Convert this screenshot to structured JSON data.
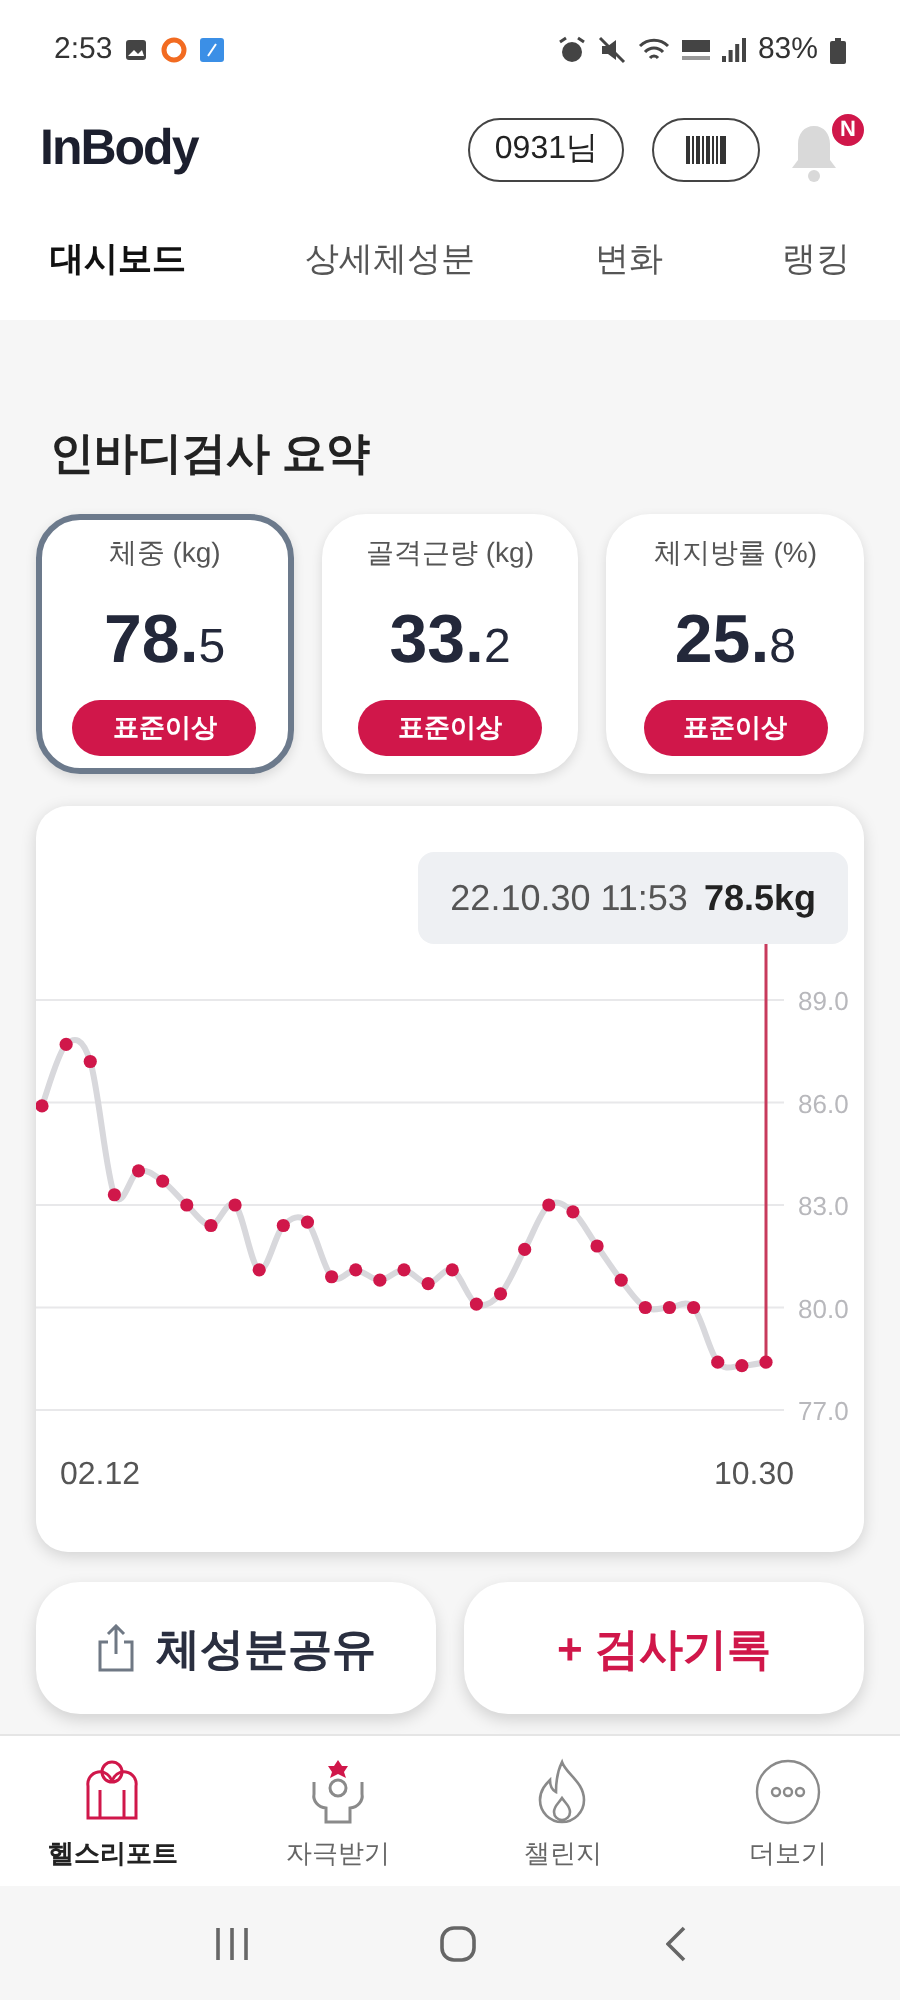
{
  "status_bar": {
    "time": "2:53",
    "battery": "83%"
  },
  "header": {
    "logo": "InBody",
    "user_button": "0931님",
    "notification_badge": "N"
  },
  "tabs": [
    {
      "label": "대시보드",
      "selected": true
    },
    {
      "label": "상세체성분",
      "selected": false
    },
    {
      "label": "변화",
      "selected": false
    },
    {
      "label": "랭킹",
      "selected": false
    }
  ],
  "summary": {
    "title": "인바디검사 요약",
    "cards": [
      {
        "label": "체중 (kg)",
        "value": "78.5",
        "status": "표준이상",
        "selected": true
      },
      {
        "label": "골격근량 (kg)",
        "value": "33.2",
        "status": "표준이상",
        "selected": false
      },
      {
        "label": "체지방률 (%)",
        "value": "25.8",
        "status": "표준이상",
        "selected": false
      }
    ]
  },
  "chart": {
    "tooltip": {
      "date": "22.10.30 11:53",
      "value": "78.5kg"
    },
    "range_start": "02.12",
    "range_end": "10.30",
    "chart_data": {
      "type": "line",
      "grid": true,
      "series": [
        {
          "color": "#d8d8dc",
          "marker": "o",
          "values": [
            85.9,
            87.7,
            87.2,
            83.3,
            84.0,
            83.7,
            83.0,
            82.4,
            83.0,
            81.1,
            82.4,
            82.5,
            80.9,
            81.1,
            80.8,
            81.1,
            80.7,
            81.1,
            80.1,
            80.4,
            81.7,
            83.0,
            82.8,
            81.8,
            80.8,
            80.0,
            80.0,
            80.0,
            78.4,
            78.3,
            78.4
          ]
        }
      ],
      "yticks": [
        {
          "value": 89,
          "label": "89.0"
        },
        {
          "value": 86,
          "label": "86.0"
        },
        {
          "value": 83,
          "label": "83.0"
        },
        {
          "value": 80,
          "label": "80.0"
        },
        {
          "value": 77,
          "label": "77.0"
        }
      ],
      "ylim": [
        77,
        89
      ]
    }
  },
  "actions": [
    {
      "kind": "share",
      "label": "체성분공유"
    },
    {
      "kind": "add",
      "label": "+ 검사기록"
    }
  ],
  "bottom_nav": [
    {
      "kind": "report",
      "label": "헬스리포트",
      "selected": true
    },
    {
      "kind": "motivation",
      "label": "자극받기",
      "selected": false
    },
    {
      "kind": "challenge",
      "label": "챌린지",
      "selected": false
    },
    {
      "kind": "more",
      "label": "더보기",
      "selected": false
    }
  ]
}
